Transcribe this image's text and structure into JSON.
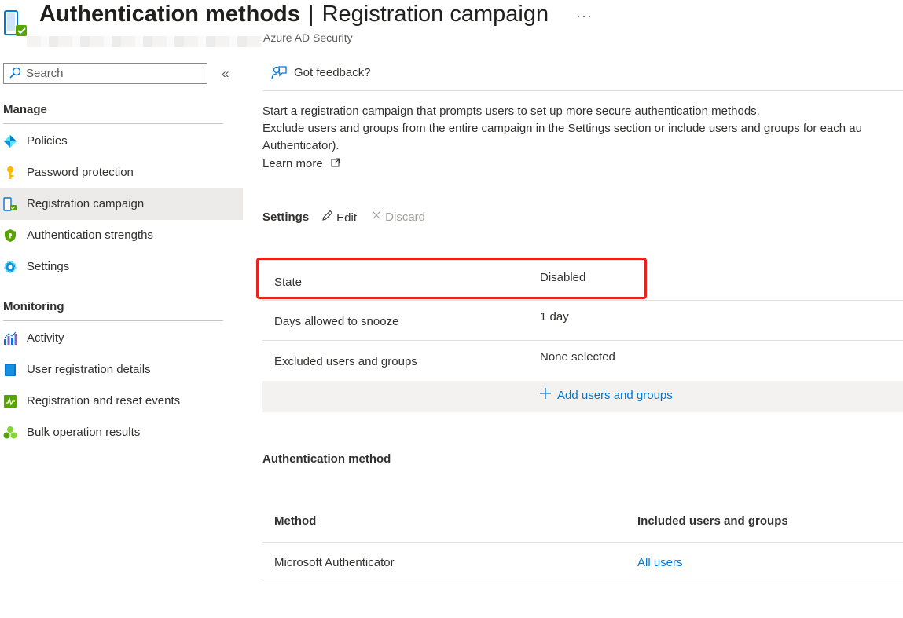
{
  "header": {
    "title_bold": "Authentication methods",
    "title_separator": "|",
    "title_rest": "Registration campaign",
    "more": "···",
    "subtitle": "Azure AD Security"
  },
  "sidebar": {
    "search_placeholder": "Search",
    "collapse": "«",
    "sections": [
      {
        "title": "Manage",
        "items": [
          {
            "label": "Policies",
            "icon": "policies-icon"
          },
          {
            "label": "Password protection",
            "icon": "key-icon"
          },
          {
            "label": "Registration campaign",
            "icon": "registration-icon",
            "active": true
          },
          {
            "label": "Authentication strengths",
            "icon": "shield-icon"
          },
          {
            "label": "Settings",
            "icon": "gear-icon"
          }
        ]
      },
      {
        "title": "Monitoring",
        "items": [
          {
            "label": "Activity",
            "icon": "activity-chart-icon"
          },
          {
            "label": "User registration details",
            "icon": "user-details-icon"
          },
          {
            "label": "Registration and reset events",
            "icon": "events-icon"
          },
          {
            "label": "Bulk operation results",
            "icon": "bulk-results-icon"
          }
        ]
      }
    ]
  },
  "main": {
    "feedback": "Got feedback?",
    "description": [
      "Start a registration campaign that prompts users to set up more secure authentication methods.",
      "Exclude users and groups from the entire campaign in the Settings section or include users and groups for each au",
      "Authenticator)."
    ],
    "learn_more": "Learn more",
    "settings": {
      "title": "Settings",
      "edit": "Edit",
      "discard": "Discard",
      "rows": [
        {
          "label": "State",
          "value": "Disabled"
        },
        {
          "label": "Days allowed to snooze",
          "value": "1 day"
        },
        {
          "label": "Excluded users and groups",
          "value": "None selected"
        }
      ],
      "add_users": "Add users and groups"
    },
    "auth_method": {
      "title": "Authentication method",
      "columns": [
        "Method",
        "Included users and groups"
      ],
      "rows": [
        {
          "method": "Microsoft Authenticator",
          "included": "All users"
        }
      ]
    }
  },
  "colors": {
    "accent": "#0078d4",
    "highlight": "#e8231b",
    "active_nav": "#edebe9"
  }
}
